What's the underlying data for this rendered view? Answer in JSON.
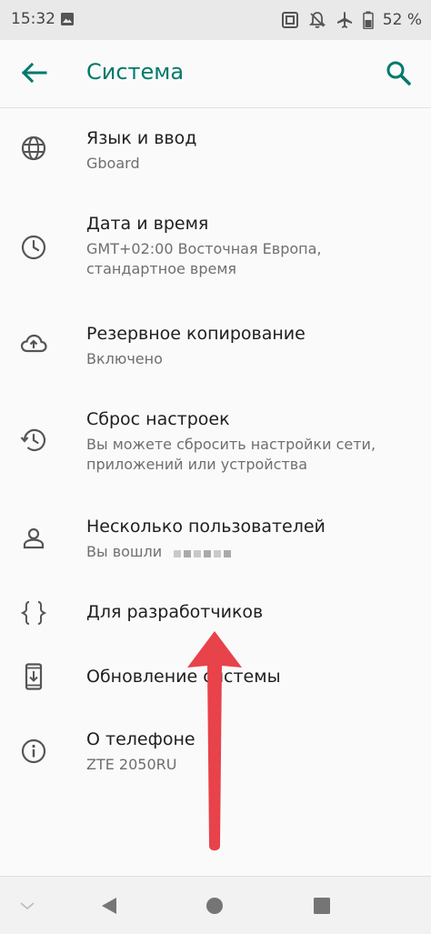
{
  "status_bar": {
    "time": "15:32",
    "battery": "52 %"
  },
  "app_bar": {
    "title": "Система"
  },
  "items": [
    {
      "title": "Язык и ввод",
      "summary": [
        "Gboard"
      ],
      "icon": "globe-icon"
    },
    {
      "title": "Дата и время",
      "summary": [
        "GMT+02:00 Восточная Европа,",
        "стандартное время"
      ],
      "icon": "clock-icon"
    },
    {
      "title": "Резервное копирование",
      "summary": [
        "Включено"
      ],
      "icon": "cloud-backup-icon"
    },
    {
      "title": "Сброс настроек",
      "summary": [
        "Вы можете сбросить настройки сети,",
        "приложений или устройства"
      ],
      "icon": "history-icon"
    },
    {
      "title": "Несколько пользователей",
      "summary": [
        "Вы вошли"
      ],
      "icon": "person-icon"
    },
    {
      "title": "Для разработчиков",
      "summary": [],
      "icon": "code-braces-icon"
    },
    {
      "title": "Обновление системы",
      "summary": [],
      "icon": "system-update-icon"
    },
    {
      "title": "О телефоне",
      "summary": [
        "ZTE 2050RU"
      ],
      "icon": "info-icon"
    }
  ],
  "colors": {
    "accent": "#00796b",
    "annotation": "#e8424a"
  }
}
